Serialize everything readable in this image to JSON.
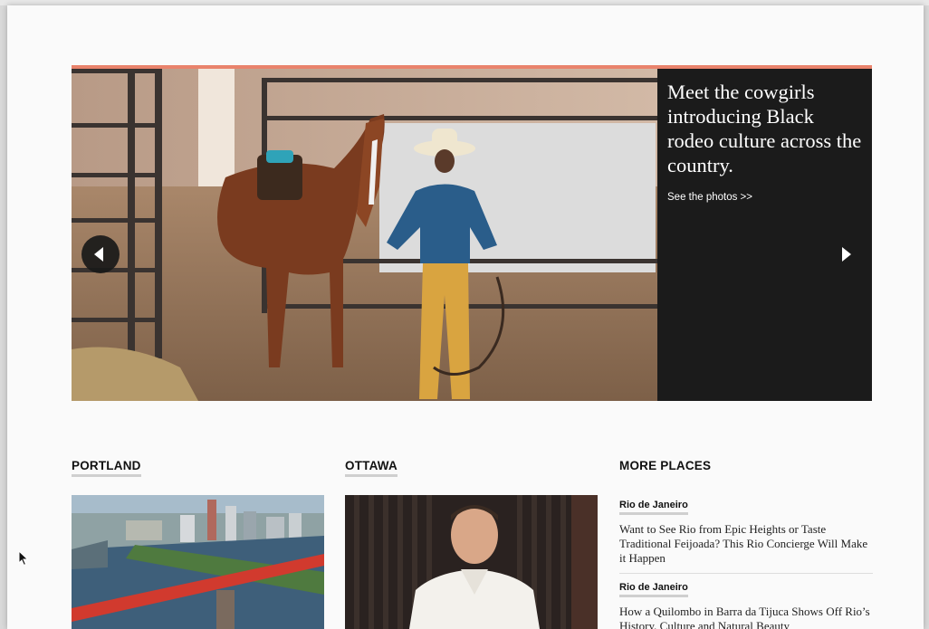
{
  "hero": {
    "headline": "Meet the cowgirls introducing Black rodeo culture across the country.",
    "link_text": "See the photos >>"
  },
  "sections": {
    "portland": {
      "title": "PORTLAND"
    },
    "ottawa": {
      "title": "OTTAWA"
    },
    "more_places": {
      "title": "MORE PLACES",
      "items": [
        {
          "tag": "Rio de Janeiro",
          "headline": "Want to See Rio from Epic Heights or Taste Traditional Feijoada? This Rio Concierge Will Make it Happen"
        },
        {
          "tag": "Rio de Janeiro",
          "headline": "How a Quilombo in Barra da Tijuca Shows Off Rio’s History, Culture and Natural Beauty"
        }
      ]
    }
  },
  "colors": {
    "accent": "#e9836c",
    "hero_panel": "#1b1b1b",
    "section_underline": "#cfcfcf"
  },
  "icons": {
    "prev": "chevron-left-icon",
    "next": "chevron-right-icon",
    "cursor": "mouse-pointer-icon"
  }
}
